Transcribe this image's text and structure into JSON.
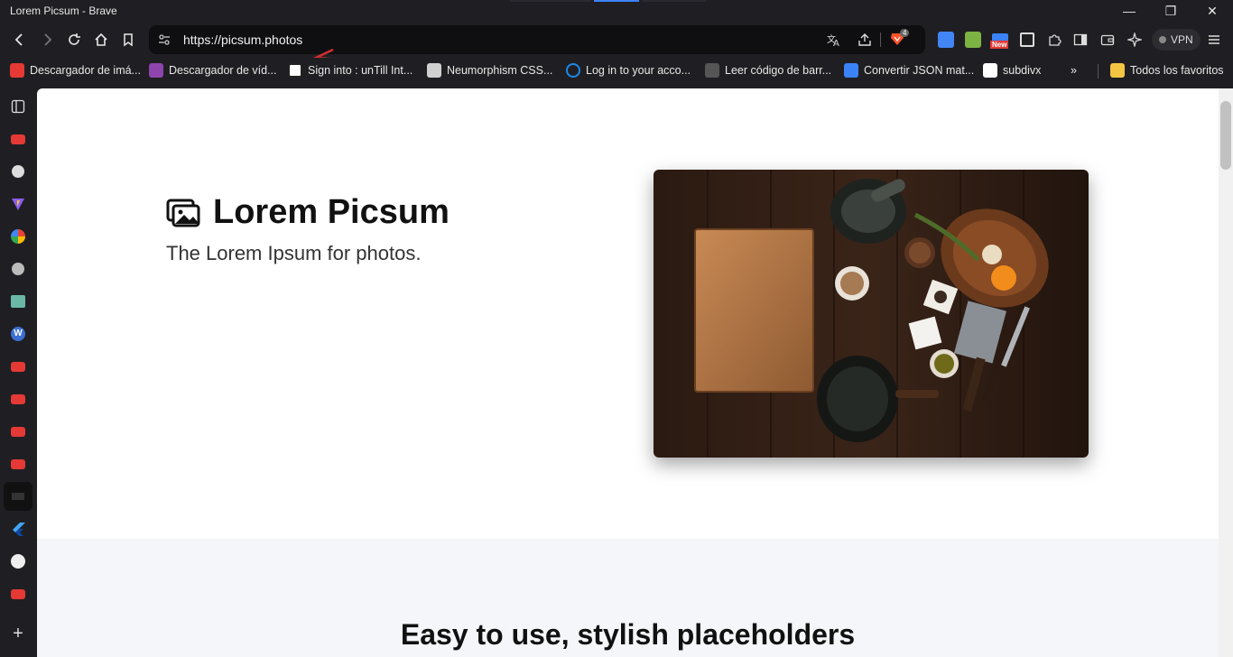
{
  "window": {
    "title": "Lorem Picsum - Brave",
    "controls": [
      "—",
      "❐",
      "✕"
    ]
  },
  "toolbar": {
    "url": "https://picsum.photos",
    "brave_shield_count": "4",
    "new_badge": "New",
    "vpn_label": "VPN"
  },
  "bookmarks": {
    "items": [
      {
        "label": "Descargador de imá...",
        "color": "#e53935"
      },
      {
        "label": "Descargador de víd...",
        "color": "#8e44ad"
      },
      {
        "label": "Sign into : unTill Int...",
        "color": "#ffffff"
      },
      {
        "label": "Neumorphism CSS...",
        "color": "#d0d0d0"
      },
      {
        "label": "Log in to your acco...",
        "color": "#1e88e5"
      },
      {
        "label": "Leer código de barr...",
        "color": "#444444"
      },
      {
        "label": "Convertir JSON mat...",
        "color": "#3b82f6"
      },
      {
        "label": "subdivx",
        "color": "#ffffff"
      }
    ],
    "more_label": "»",
    "all_favorites_label": "Todos los favoritos"
  },
  "sidebar": {
    "icons": [
      "sidebar-panel-icon",
      "youtube-icon",
      "puzzle-icon",
      "vite-icon",
      "google-icon",
      "globe-icon",
      "image-icon",
      "wordpress-icon",
      "youtube-icon",
      "youtube-icon",
      "youtube-icon",
      "youtube-icon",
      "app-icon",
      "flutter-icon",
      "github-icon",
      "youtube-icon"
    ],
    "add_label": "+"
  },
  "page": {
    "hero_title": "Lorem Picsum",
    "hero_subtitle": "The Lorem Ipsum for photos.",
    "section_heading": "Easy to use, stylish placeholders"
  },
  "colors": {
    "browser_bg": "#1f1f23",
    "url_field_bg": "#0f0f12",
    "section_bg": "#f4f6f9",
    "annotation_arrow": "#d32f2f"
  }
}
